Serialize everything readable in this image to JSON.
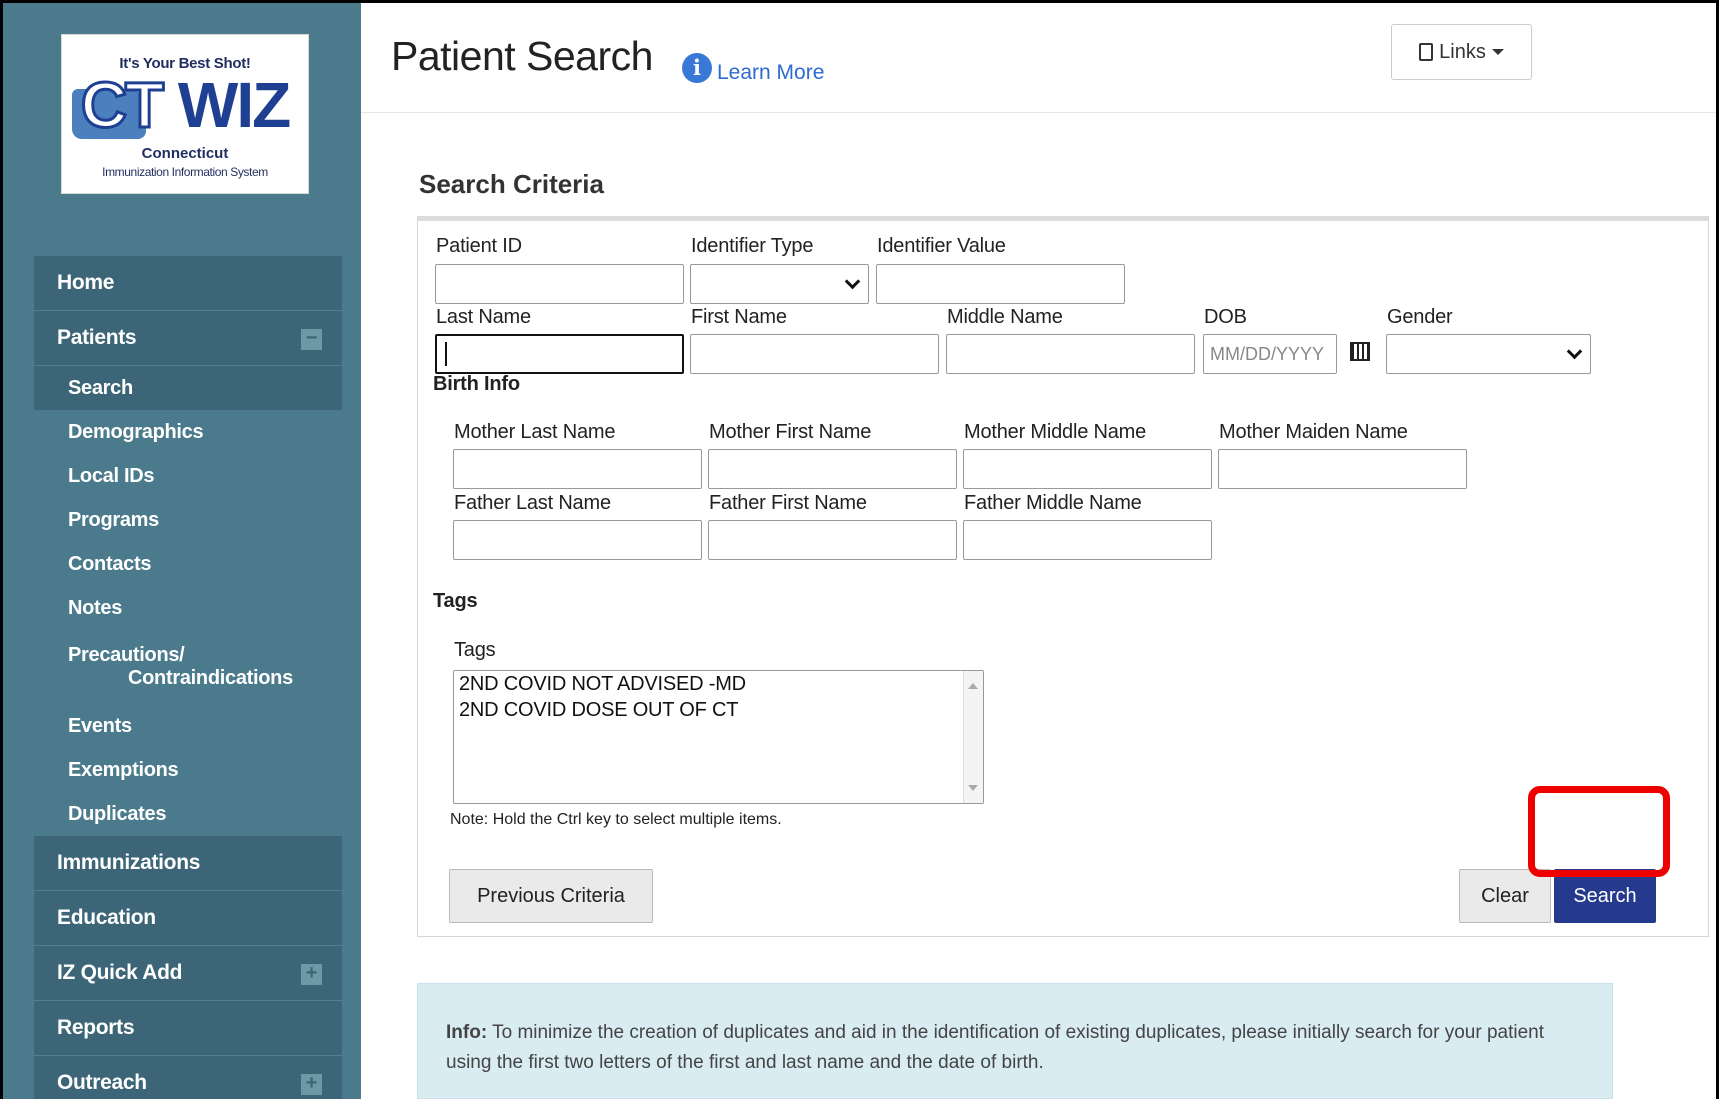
{
  "logo": {
    "tagline": "It's Your Best Shot!",
    "wordmark_a": "CT",
    "wordmark_b": "WIZ",
    "region": "Connecticut",
    "system": "Immunization Information System"
  },
  "sidebar": {
    "items": [
      {
        "label": "Home"
      },
      {
        "label": "Patients",
        "toggle": "−"
      },
      {
        "label": "Search"
      },
      {
        "label": "Demographics"
      },
      {
        "label": "Local IDs"
      },
      {
        "label": "Programs"
      },
      {
        "label": "Contacts"
      },
      {
        "label": "Notes"
      },
      {
        "label": "Precautions/",
        "label2": "Contraindications"
      },
      {
        "label": "Events"
      },
      {
        "label": "Exemptions"
      },
      {
        "label": "Duplicates"
      },
      {
        "label": "Immunizations"
      },
      {
        "label": "Education"
      },
      {
        "label": "IZ Quick Add",
        "toggle": "+"
      },
      {
        "label": "Reports"
      },
      {
        "label": "Outreach",
        "toggle": "+"
      }
    ]
  },
  "header": {
    "title": "Patient Search",
    "info_glyph": "i",
    "learn_more": "Learn More",
    "links_label": "Links"
  },
  "form": {
    "section_title": "Search Criteria",
    "patient_id": "Patient ID",
    "identifier_type": "Identifier Type",
    "identifier_value": "Identifier Value",
    "last_name": "Last Name",
    "first_name": "First Name",
    "middle_name": "Middle Name",
    "dob": "DOB",
    "dob_placeholder": "MM/DD/YYYY",
    "gender": "Gender",
    "birth_info": "Birth Info",
    "mother_last": "Mother Last Name",
    "mother_first": "Mother First Name",
    "mother_middle": "Mother Middle Name",
    "mother_maiden": "Mother Maiden Name",
    "father_last": "Father Last Name",
    "father_first": "Father First Name",
    "father_middle": "Father Middle Name",
    "tags_section": "Tags",
    "tags_label": "Tags",
    "tag_options": [
      "2ND COVID NOT ADVISED -MD",
      "2ND COVID DOSE OUT OF CT"
    ],
    "note": "Note: Hold the Ctrl key to select multiple items.",
    "previous_criteria": "Previous Criteria",
    "clear": "Clear",
    "search": "Search"
  },
  "info": {
    "lead": "Info:",
    "text": " To minimize the creation of duplicates and aid in the identification of existing duplicates, please initially search for your patient using the first two letters of the first and last name and the date of birth."
  },
  "colors": {
    "sidebar": "#4a7a8c",
    "nav_dark": "#3c6677",
    "primary_button": "#253a8c",
    "highlight": "#e00000",
    "info_bg": "#d9ecf2"
  }
}
